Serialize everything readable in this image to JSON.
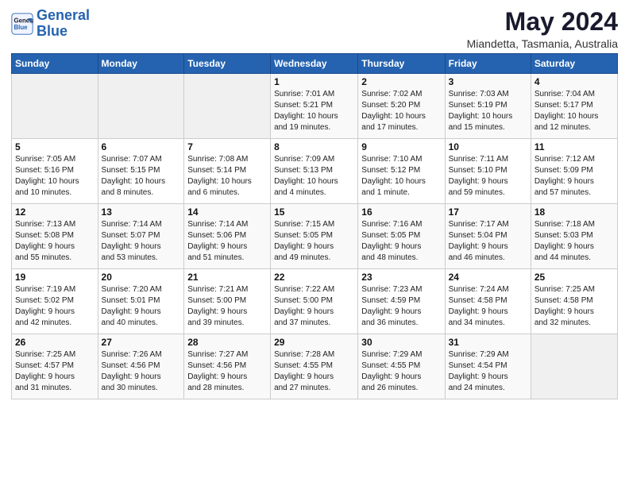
{
  "logo": {
    "line1": "General",
    "line2": "Blue"
  },
  "title": "May 2024",
  "subtitle": "Miandetta, Tasmania, Australia",
  "weekdays": [
    "Sunday",
    "Monday",
    "Tuesday",
    "Wednesday",
    "Thursday",
    "Friday",
    "Saturday"
  ],
  "weeks": [
    [
      {
        "day": "",
        "info": ""
      },
      {
        "day": "",
        "info": ""
      },
      {
        "day": "",
        "info": ""
      },
      {
        "day": "1",
        "info": "Sunrise: 7:01 AM\nSunset: 5:21 PM\nDaylight: 10 hours\nand 19 minutes."
      },
      {
        "day": "2",
        "info": "Sunrise: 7:02 AM\nSunset: 5:20 PM\nDaylight: 10 hours\nand 17 minutes."
      },
      {
        "day": "3",
        "info": "Sunrise: 7:03 AM\nSunset: 5:19 PM\nDaylight: 10 hours\nand 15 minutes."
      },
      {
        "day": "4",
        "info": "Sunrise: 7:04 AM\nSunset: 5:17 PM\nDaylight: 10 hours\nand 12 minutes."
      }
    ],
    [
      {
        "day": "5",
        "info": "Sunrise: 7:05 AM\nSunset: 5:16 PM\nDaylight: 10 hours\nand 10 minutes."
      },
      {
        "day": "6",
        "info": "Sunrise: 7:07 AM\nSunset: 5:15 PM\nDaylight: 10 hours\nand 8 minutes."
      },
      {
        "day": "7",
        "info": "Sunrise: 7:08 AM\nSunset: 5:14 PM\nDaylight: 10 hours\nand 6 minutes."
      },
      {
        "day": "8",
        "info": "Sunrise: 7:09 AM\nSunset: 5:13 PM\nDaylight: 10 hours\nand 4 minutes."
      },
      {
        "day": "9",
        "info": "Sunrise: 7:10 AM\nSunset: 5:12 PM\nDaylight: 10 hours\nand 1 minute."
      },
      {
        "day": "10",
        "info": "Sunrise: 7:11 AM\nSunset: 5:10 PM\nDaylight: 9 hours\nand 59 minutes."
      },
      {
        "day": "11",
        "info": "Sunrise: 7:12 AM\nSunset: 5:09 PM\nDaylight: 9 hours\nand 57 minutes."
      }
    ],
    [
      {
        "day": "12",
        "info": "Sunrise: 7:13 AM\nSunset: 5:08 PM\nDaylight: 9 hours\nand 55 minutes."
      },
      {
        "day": "13",
        "info": "Sunrise: 7:14 AM\nSunset: 5:07 PM\nDaylight: 9 hours\nand 53 minutes."
      },
      {
        "day": "14",
        "info": "Sunrise: 7:14 AM\nSunset: 5:06 PM\nDaylight: 9 hours\nand 51 minutes."
      },
      {
        "day": "15",
        "info": "Sunrise: 7:15 AM\nSunset: 5:05 PM\nDaylight: 9 hours\nand 49 minutes."
      },
      {
        "day": "16",
        "info": "Sunrise: 7:16 AM\nSunset: 5:05 PM\nDaylight: 9 hours\nand 48 minutes."
      },
      {
        "day": "17",
        "info": "Sunrise: 7:17 AM\nSunset: 5:04 PM\nDaylight: 9 hours\nand 46 minutes."
      },
      {
        "day": "18",
        "info": "Sunrise: 7:18 AM\nSunset: 5:03 PM\nDaylight: 9 hours\nand 44 minutes."
      }
    ],
    [
      {
        "day": "19",
        "info": "Sunrise: 7:19 AM\nSunset: 5:02 PM\nDaylight: 9 hours\nand 42 minutes."
      },
      {
        "day": "20",
        "info": "Sunrise: 7:20 AM\nSunset: 5:01 PM\nDaylight: 9 hours\nand 40 minutes."
      },
      {
        "day": "21",
        "info": "Sunrise: 7:21 AM\nSunset: 5:00 PM\nDaylight: 9 hours\nand 39 minutes."
      },
      {
        "day": "22",
        "info": "Sunrise: 7:22 AM\nSunset: 5:00 PM\nDaylight: 9 hours\nand 37 minutes."
      },
      {
        "day": "23",
        "info": "Sunrise: 7:23 AM\nSunset: 4:59 PM\nDaylight: 9 hours\nand 36 minutes."
      },
      {
        "day": "24",
        "info": "Sunrise: 7:24 AM\nSunset: 4:58 PM\nDaylight: 9 hours\nand 34 minutes."
      },
      {
        "day": "25",
        "info": "Sunrise: 7:25 AM\nSunset: 4:58 PM\nDaylight: 9 hours\nand 32 minutes."
      }
    ],
    [
      {
        "day": "26",
        "info": "Sunrise: 7:25 AM\nSunset: 4:57 PM\nDaylight: 9 hours\nand 31 minutes."
      },
      {
        "day": "27",
        "info": "Sunrise: 7:26 AM\nSunset: 4:56 PM\nDaylight: 9 hours\nand 30 minutes."
      },
      {
        "day": "28",
        "info": "Sunrise: 7:27 AM\nSunset: 4:56 PM\nDaylight: 9 hours\nand 28 minutes."
      },
      {
        "day": "29",
        "info": "Sunrise: 7:28 AM\nSunset: 4:55 PM\nDaylight: 9 hours\nand 27 minutes."
      },
      {
        "day": "30",
        "info": "Sunrise: 7:29 AM\nSunset: 4:55 PM\nDaylight: 9 hours\nand 26 minutes."
      },
      {
        "day": "31",
        "info": "Sunrise: 7:29 AM\nSunset: 4:54 PM\nDaylight: 9 hours\nand 24 minutes."
      },
      {
        "day": "",
        "info": ""
      }
    ]
  ]
}
